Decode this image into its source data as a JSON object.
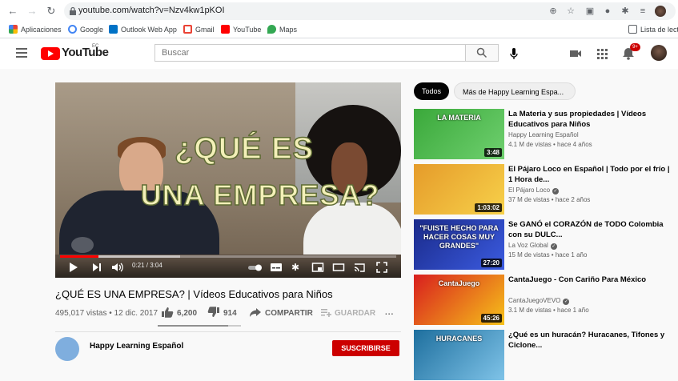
{
  "browser": {
    "url": "youtube.com/watch?v=Nzv4kw1pKOI",
    "bookmarks": [
      {
        "label": "Aplicaciones",
        "color": "#1a73e8"
      },
      {
        "label": "Google",
        "color": "#4285f4"
      },
      {
        "label": "Outlook Web App",
        "color": "#0072c6"
      },
      {
        "label": "Gmail",
        "color": "#ea4335"
      },
      {
        "label": "YouTube",
        "color": "#ff0000"
      },
      {
        "label": "Maps",
        "color": "#34a853"
      }
    ],
    "reading_list": "Lista de lectu"
  },
  "youtube": {
    "logo_text": "YouTube",
    "country": "EC",
    "search_placeholder": "Buscar",
    "notifications": "9+"
  },
  "player": {
    "overlay_line1": "¿QUÉ ES",
    "overlay_line2": "UNA EMPRESA?",
    "time": "0:21 / 3:04",
    "progress_fraction": 0.114
  },
  "video": {
    "title": "¿QUÉ ES UNA EMPRESA? | Vídeos Educativos para Niños",
    "stats": "495,017 vistas • 12 dic. 2017",
    "likes": "6,200",
    "dislikes": "914",
    "share": "COMPARTIR",
    "save": "GUARDAR",
    "more": "...",
    "channel": "Happy Learning Español",
    "subscribe": "SUSCRIBIRSE"
  },
  "chips": {
    "all": "Todos",
    "more": "Más de Happy Learning Espa..."
  },
  "recommendations": [
    {
      "title": "La Materia y sus propiedades | Vídeos Educativos para Niños",
      "channel": "Happy Learning Español",
      "meta": "4.1 M de vistas • hace 4 años",
      "duration": "3:48",
      "verified": false,
      "thumb_text": "LA MATERIA",
      "colors": [
        "#3aa83a",
        "#6fd06f"
      ]
    },
    {
      "title": "El Pájaro Loco en Español | Todo por el frío | 1 Hora de...",
      "channel": "El Pájaro Loco",
      "meta": "37 M de vistas • hace 2 años",
      "duration": "1:03:02",
      "verified": true,
      "thumb_text": "",
      "colors": [
        "#e59b2a",
        "#f7d14a"
      ]
    },
    {
      "title": "Se GANÓ el CORAZÓN de TODO Colombia con su DULC...",
      "channel": "La Voz Global",
      "meta": "15 M de vistas • hace 1 año",
      "duration": "27:20",
      "verified": true,
      "thumb_text": "\"FUISTE HECHO PARA HACER COSAS MUY GRANDES\"",
      "colors": [
        "#1a2a8a",
        "#3b5be0"
      ]
    },
    {
      "title": "CantaJuego - Con Cariño Para México",
      "channel": "CantaJuegoVEVO",
      "meta": "3.1 M de vistas • hace 1 año",
      "duration": "45:26",
      "verified": true,
      "thumb_text": "CantaJuego",
      "colors": [
        "#d81e1e",
        "#f6c21a"
      ]
    },
    {
      "title": "¿Qué es un huracán? Huracanes, Tifones y Ciclone...",
      "channel": "",
      "meta": "",
      "duration": "",
      "verified": false,
      "thumb_text": "HURACANES",
      "colors": [
        "#1e6f9e",
        "#7fc3e8"
      ]
    }
  ]
}
